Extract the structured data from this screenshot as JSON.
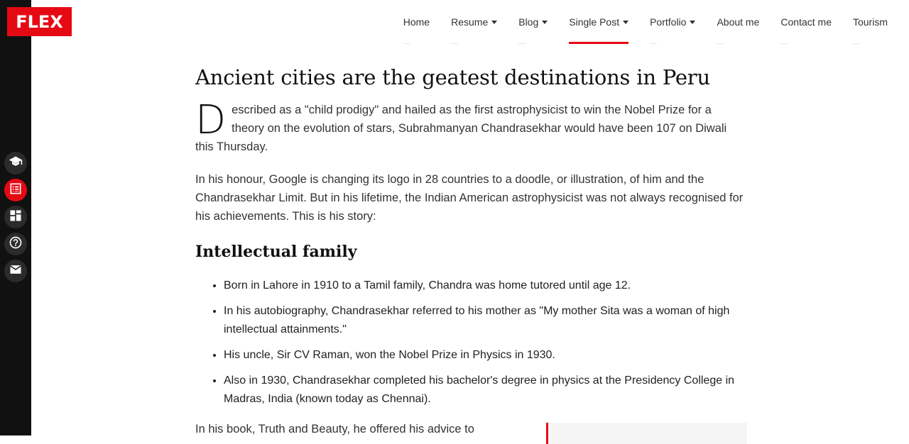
{
  "logo": {
    "text": "FLEX"
  },
  "sidebar": {
    "icons": [
      {
        "name": "graduation-cap-icon",
        "active": false
      },
      {
        "name": "list-card-icon",
        "active": true
      },
      {
        "name": "dashboard-grid-icon",
        "active": false
      },
      {
        "name": "help-circle-icon",
        "active": false
      },
      {
        "name": "mail-icon",
        "active": false
      }
    ]
  },
  "nav": {
    "items": [
      {
        "label": "Home",
        "has_dropdown": false,
        "active": false
      },
      {
        "label": "Resume",
        "has_dropdown": true,
        "active": false
      },
      {
        "label": "Blog",
        "has_dropdown": true,
        "active": false
      },
      {
        "label": "Single Post",
        "has_dropdown": true,
        "active": true
      },
      {
        "label": "Portfolio",
        "has_dropdown": true,
        "active": false
      },
      {
        "label": "About me",
        "has_dropdown": false,
        "active": false
      },
      {
        "label": "Contact me",
        "has_dropdown": false,
        "active": false
      },
      {
        "label": "Tourism",
        "has_dropdown": false,
        "active": false
      }
    ]
  },
  "post": {
    "title": "Ancient cities are the geatest destinations in Peru",
    "lead_dropcap": "D",
    "lead_rest": "escribed as a \"child prodigy\" and hailed as the first astrophysicist to win the Nobel Prize for a theory on the evolution of stars, Subrahmanyan Chandrasekhar would have been 107 on Diwali this Thursday.",
    "paragraph_2": "In his honour, Google is changing its logo in 28 countries to a doodle, or illustration, of him and the Chandrasekhar Limit. But in his lifetime, the Indian American astrophysicist was not always recognised for his achievements. This is his story:",
    "section_title": "Intellectual family",
    "bullets": [
      "Born in Lahore in 1910 to a Tamil family, Chandra was home tutored until age 12.",
      "In his autobiography, Chandrasekhar referred to his mother as \"My mother Sita was a woman of high intellectual attainments.\"",
      "His uncle, Sir CV Raman, won the Nobel Prize in Physics in 1930.",
      "Also in 1930, Chandrasekhar completed his bachelor's degree in physics at the Presidency College in Madras, India (known today as Chennai)."
    ],
    "bottom_text": "In his book, Truth and Beauty, he offered his advice to"
  },
  "colors": {
    "accent": "#e50914",
    "sidebar": "#111111"
  }
}
